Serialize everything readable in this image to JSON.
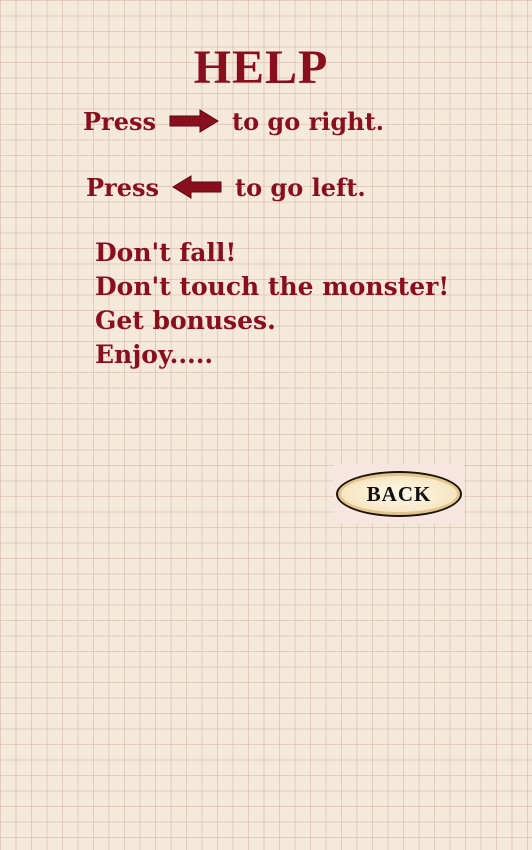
{
  "title": "HELP",
  "controls": {
    "right": {
      "press": "Press",
      "action": "to go right.",
      "icon": "right-arrow-icon"
    },
    "left": {
      "press": "Press",
      "action": "to go left.",
      "icon": "left-arrow-icon"
    }
  },
  "rules": [
    "Don't fall!",
    "Don't touch the monster!",
    "Get bonuses.",
    "Enjoy....."
  ],
  "back_button": {
    "label": "BACK"
  },
  "colors": {
    "text": "#8a0f1e",
    "background": "#f4e9db",
    "grid": "#cdaa96"
  }
}
